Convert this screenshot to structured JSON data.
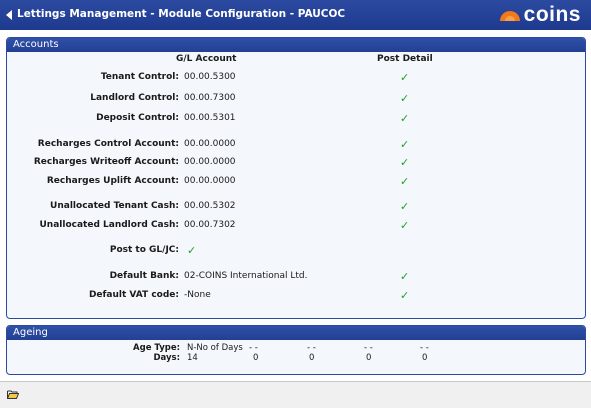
{
  "window": {
    "title": "Lettings Management - Module Configuration - PAUCOC",
    "logo_text": "coins"
  },
  "accounts": {
    "header": "Accounts",
    "col_gl": "G/L Account",
    "col_post": "Post Detail",
    "rows": [
      {
        "label": "Tenant Control:",
        "value": "00.00.5300",
        "post": "✓"
      },
      {
        "label": "Landlord Control:",
        "value": "00.00.7300",
        "post": "✓"
      },
      {
        "label": "Deposit Control:",
        "value": "00.00.5301",
        "post": "✓"
      },
      {
        "label": "Recharges Control Account:",
        "value": "00.00.0000",
        "post": "✓"
      },
      {
        "label": "Recharges Writeoff Account:",
        "value": "00.00.0000",
        "post": "✓"
      },
      {
        "label": "Recharges Uplift Account:",
        "value": "00.00.0000",
        "post": "✓"
      },
      {
        "label": "Unallocated Tenant Cash:",
        "value": "00.00.5302",
        "post": "✓"
      },
      {
        "label": "Unallocated Landlord Cash:",
        "value": "00.00.7302",
        "post": "✓"
      },
      {
        "label": "Post to GL/JC:",
        "value": "✓"
      },
      {
        "label": "Default Bank:",
        "value": "02-COINS International Ltd.",
        "post": "✓"
      },
      {
        "label": "Default VAT code:",
        "value": "-None",
        "post": "✓"
      }
    ]
  },
  "ageing": {
    "header": "Ageing",
    "age_type_label": "Age Type:",
    "days_label": "Days:",
    "age_types": [
      "N-No of Days",
      "- -",
      "- -",
      "- -",
      "- -"
    ],
    "days": [
      "14",
      "0",
      "0",
      "0",
      "0"
    ]
  },
  "footer": {
    "icon": "folder-open-icon"
  },
  "colors": {
    "title_bar": "#1d3a8f",
    "check": "#22a022",
    "logo_orange": "#f07a1a"
  }
}
